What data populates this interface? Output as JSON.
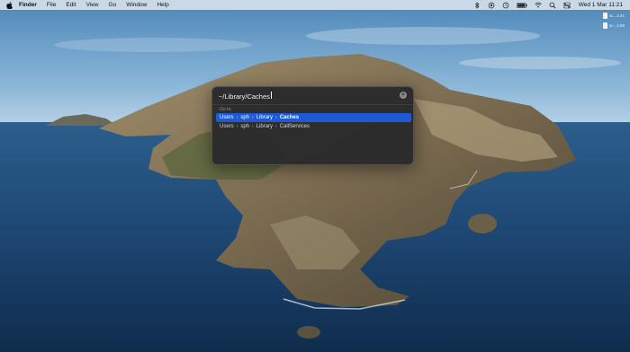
{
  "menubar": {
    "app_name": "Finder",
    "menus": [
      "File",
      "Edit",
      "View",
      "Go",
      "Window",
      "Help"
    ],
    "clock": "Wed 1 Mar  11:21",
    "status_icons": [
      "bluetooth-icon",
      "record-icon",
      "timemachine-icon",
      "battery-icon",
      "wifi-icon",
      "search-icon",
      "control-center-icon"
    ]
  },
  "desktop": {
    "items": [
      {
        "label": "sc...3.41",
        "icon": "file-icon"
      },
      {
        "label": "sc...3.59",
        "icon": "file-icon"
      }
    ]
  },
  "goto": {
    "path_value": "~/Library/Caches",
    "section_label": "Go to:",
    "results": [
      {
        "crumbs": [
          "Users",
          "sph",
          "Library",
          "Caches"
        ],
        "selected": true
      },
      {
        "crumbs": [
          "Users",
          "sph",
          "Library",
          "CallServices"
        ],
        "selected": false
      }
    ]
  },
  "colors": {
    "selection": "#1d5ad3",
    "panel": "#28282a",
    "menubar": "#ecf0f5"
  }
}
